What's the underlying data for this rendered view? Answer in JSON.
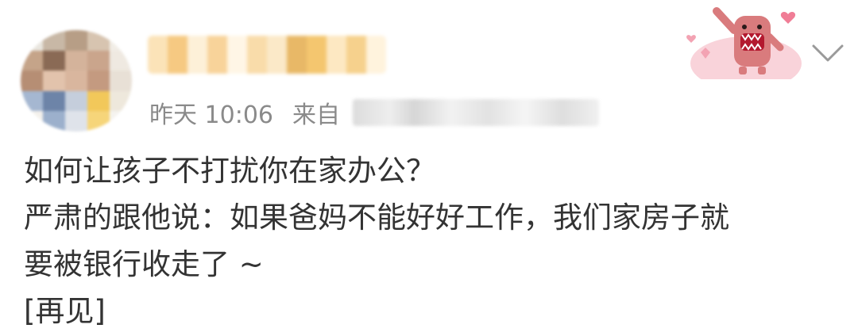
{
  "post": {
    "timestamp": "昨天 10:06",
    "source_prefix": "来自",
    "lines": [
      "如何让孩子不打扰你在家办公？",
      "严肃的跟他说：如果爸妈不能好好工作，我们家房子就",
      "要被银行收走了 ~",
      "[再见]"
    ]
  },
  "icons": {
    "sticker": "domo-kun-waving-sticker-icon",
    "chevron": "chevron-down-icon"
  },
  "colors": {
    "text": "#333333",
    "meta_text": "#8a8a8a",
    "sticker_pink": "#f7c6cf",
    "sticker_red": "#e0364a"
  }
}
